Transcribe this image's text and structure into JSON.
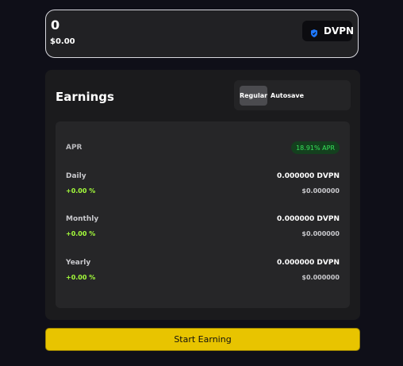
{
  "amount": {
    "value": "0",
    "usd": "$0.00"
  },
  "token": {
    "label": "DVPN",
    "icon": "dvpn-shield-icon",
    "icon_color": "#1e78ff"
  },
  "earnings": {
    "title": "Earnings",
    "modes": {
      "regular": "Regular",
      "autosave": "Autosave",
      "selected": "Regular"
    },
    "apr": {
      "label": "APR",
      "value": "18.91% APR"
    },
    "rows": [
      {
        "label": "Daily",
        "change": "+0.00 %",
        "amount": "0.000000 DVPN",
        "usd": "$0.000000"
      },
      {
        "label": "Monthly",
        "change": "+0.00 %",
        "amount": "0.000000 DVPN",
        "usd": "$0.000000"
      },
      {
        "label": "Yearly",
        "change": "+0.00 %",
        "amount": "0.000000 DVPN",
        "usd": "$0.000000"
      }
    ]
  },
  "actions": {
    "start_label": "Start Earning"
  },
  "colors": {
    "accent": "#e8c400",
    "positive": "#a6ff3c",
    "apr_text": "#36e35a",
    "background": "#0f0f18"
  }
}
